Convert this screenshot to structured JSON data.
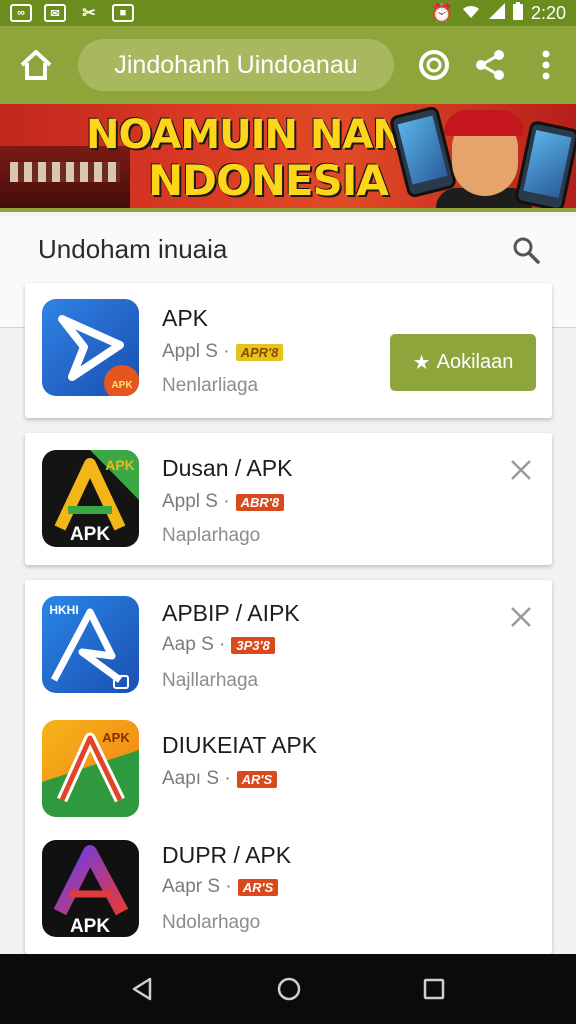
{
  "status_bar": {
    "time": "2:20"
  },
  "toolbar": {
    "url_text": "Jindohanh Uindoanau"
  },
  "banner": {
    "line1": "NOAMUIN NAN",
    "line2": "NDONESIA"
  },
  "section": {
    "title": "Undoham inuaia"
  },
  "apps": [
    {
      "name": "APK",
      "meta": "Appl S ·",
      "badge": "APR'8",
      "subtitle": "Nenlarliaga",
      "action": "Aokilaan"
    },
    {
      "name": "Dusan / APK",
      "meta": "Appl S ·",
      "badge": "ABR'8",
      "subtitle": "Naplarhago"
    },
    {
      "name": "APBIP / AIPK",
      "meta": "Aap S ·",
      "badge": "3P3'8",
      "subtitle": "Najllarhaga"
    },
    {
      "name": "DIUKEIAT APK",
      "meta": "Aapı S ·",
      "badge": "AR'S",
      "subtitle": ""
    },
    {
      "name": "DUPR / APK",
      "meta": "Aapr S ·",
      "badge": "AR'S",
      "subtitle": "Ndolarhago"
    }
  ],
  "icon_labels": {
    "apk_1": "APK",
    "apk_1_small": "APK",
    "apk_4": "APK",
    "hkhi": "HKHI",
    "apk_5": "APK"
  },
  "colors": {
    "accent": "#8ea53b",
    "status_bar": "#6b8d1e",
    "badge": "#d84a1b"
  }
}
